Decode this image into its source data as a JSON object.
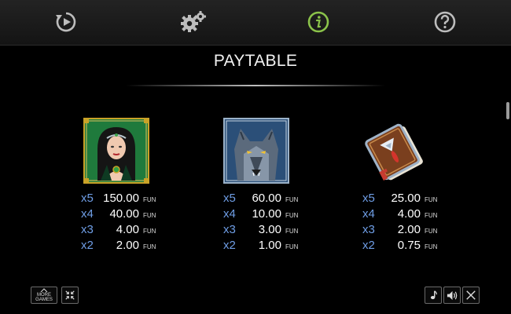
{
  "topbar": {
    "buttons": [
      {
        "name": "replay",
        "icon": "replay-icon"
      },
      {
        "name": "settings",
        "icon": "gears-icon"
      },
      {
        "name": "info",
        "icon": "info-icon",
        "active_color": "#8bc34a"
      },
      {
        "name": "help",
        "icon": "help-icon"
      }
    ]
  },
  "page": {
    "title": "PAYTABLE"
  },
  "symbols": [
    {
      "icon": "sorceress-icon",
      "pays": [
        {
          "mult": "x5",
          "amount": "150.00",
          "currency": "FUN"
        },
        {
          "mult": "x4",
          "amount": "40.00",
          "currency": "FUN"
        },
        {
          "mult": "x3",
          "amount": "4.00",
          "currency": "FUN"
        },
        {
          "mult": "x2",
          "amount": "2.00",
          "currency": "FUN"
        }
      ]
    },
    {
      "icon": "wolf-icon",
      "pays": [
        {
          "mult": "x5",
          "amount": "60.00",
          "currency": "FUN"
        },
        {
          "mult": "x4",
          "amount": "10.00",
          "currency": "FUN"
        },
        {
          "mult": "x3",
          "amount": "3.00",
          "currency": "FUN"
        },
        {
          "mult": "x2",
          "amount": "1.00",
          "currency": "FUN"
        }
      ]
    },
    {
      "icon": "spellbook-icon",
      "pays": [
        {
          "mult": "x5",
          "amount": "25.00",
          "currency": "FUN"
        },
        {
          "mult": "x4",
          "amount": "4.00",
          "currency": "FUN"
        },
        {
          "mult": "x3",
          "amount": "2.00",
          "currency": "FUN"
        },
        {
          "mult": "x2",
          "amount": "0.75",
          "currency": "FUN"
        }
      ]
    }
  ],
  "bottombar": {
    "more_games_line1": "MORE",
    "more_games_line2": "GAMES",
    "buttons_right": [
      "music-icon",
      "sound-icon",
      "close-icon"
    ],
    "button_left": "collapse-icon"
  },
  "colors": {
    "multiplier": "#6f9ee6",
    "accent_info": "#8bc34a",
    "background": "#000000"
  }
}
